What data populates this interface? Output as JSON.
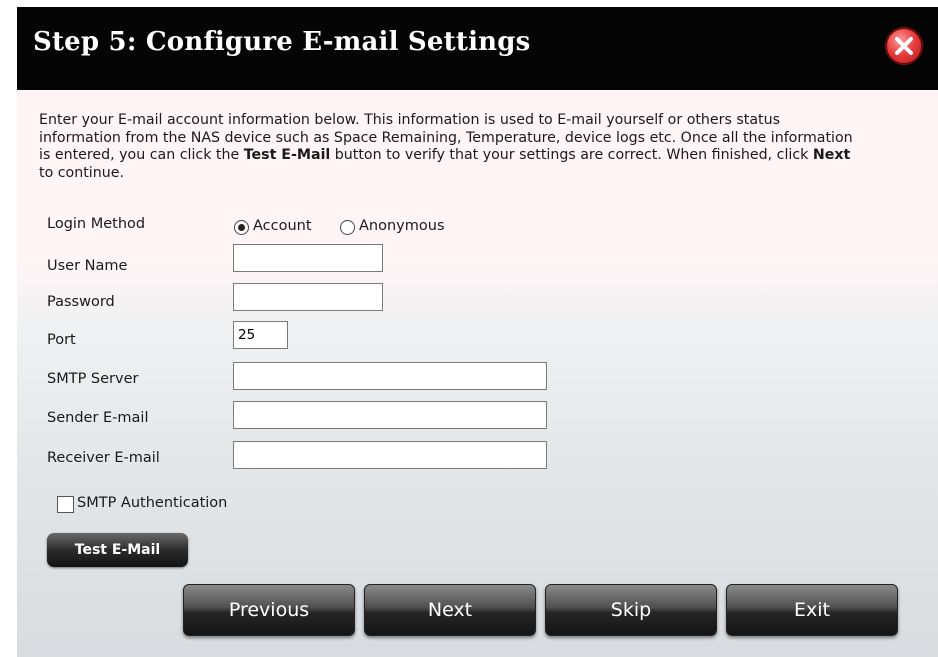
{
  "dialog": {
    "title": "Step 5: Configure E-mail Settings",
    "close_icon": "close-icon"
  },
  "intro": {
    "part1": "Enter your E-mail account information below. This information is used to E-mail yourself or others status information from the NAS device such as Space Remaining, Temperature, device logs etc. Once all the information is entered, you can click the ",
    "test_bold": "Test E-Mail",
    "part2": " button to verify that your settings are correct. When finished, click ",
    "next_bold": "Next",
    "part3": " to continue."
  },
  "form": {
    "login_method_label": "Login Method",
    "login_method_options": [
      "Account",
      "Anonymous"
    ],
    "login_method_selected": "Account",
    "user_name_label": "User Name",
    "user_name_value": "",
    "password_label": "Password",
    "password_value": "",
    "port_label": "Port",
    "port_value": "25",
    "smtp_server_label": "SMTP Server",
    "smtp_server_value": "",
    "sender_label": "Sender E-mail",
    "sender_value": "",
    "receiver_label": "Receiver E-mail",
    "receiver_value": "",
    "smtp_auth_label": "SMTP Authentication",
    "smtp_auth_checked": false
  },
  "buttons": {
    "test_email": "Test E-Mail",
    "previous": "Previous",
    "next": "Next",
    "skip": "Skip",
    "exit": "Exit"
  }
}
